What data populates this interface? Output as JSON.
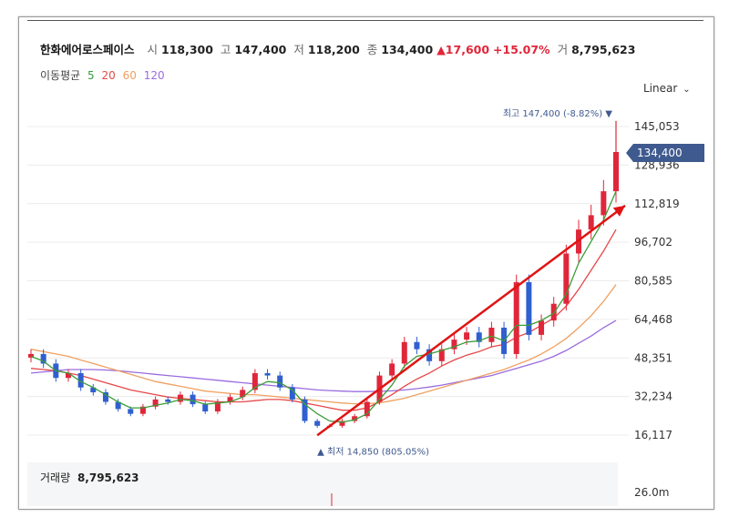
{
  "header": {
    "name": "한화에어로스페이스",
    "open_label": "시",
    "open": "118,300",
    "high_label": "고",
    "high": "147,400",
    "low_label": "저",
    "low": "118,200",
    "close_label": "종",
    "close": "134,400",
    "change": "▲17,600",
    "change_pct": "+15.07%",
    "volume_label": "거",
    "volume": "8,795,623"
  },
  "ma_legend": {
    "label": "이동평균",
    "p5": "5",
    "p20": "20",
    "p60": "60",
    "p120": "120"
  },
  "scale": "Linear",
  "colors": {
    "up": "#e0263a",
    "down": "#2f5fd0",
    "ma5": "#3a9d3a",
    "ma20": "#e64848",
    "ma60": "#f0a060",
    "ma120": "#9a6ce0",
    "trend": "#e01414",
    "badge": "#3f5a8e"
  },
  "chart_data": {
    "type": "line",
    "y_ticks": [
      "145,053",
      "128,936",
      "112,819",
      "96,702",
      "80,585",
      "64,468",
      "48,351",
      "32,234",
      "16,117"
    ],
    "y_tick_values": [
      145053,
      128936,
      112819,
      96702,
      80585,
      64468,
      48351,
      32234,
      16117
    ],
    "ylim": [
      12000,
      158000
    ],
    "current_price": "134,400",
    "current_price_value": 134400,
    "high_annotation": "최고 147,400 (-8.82%)",
    "high_value": 147400,
    "low_annotation": "최저 14,850 (805.05%)",
    "low_value": 14850,
    "n": 48,
    "close": [
      50000,
      46000,
      40000,
      42000,
      36000,
      34000,
      30000,
      27000,
      25000,
      28000,
      31000,
      30000,
      33000,
      29000,
      26000,
      30000,
      32000,
      35000,
      42000,
      41000,
      36000,
      31000,
      22000,
      20000,
      20000,
      22000,
      24000,
      30000,
      41000,
      46000,
      55000,
      52000,
      47000,
      52000,
      56000,
      59000,
      55000,
      61000,
      50000,
      80000,
      58000,
      64000,
      71000,
      92000,
      102000,
      108000,
      118000,
      134400
    ],
    "ma5": [
      49000,
      47000,
      43000,
      42000,
      38500,
      36000,
      33000,
      30000,
      27500,
      27500,
      28500,
      29500,
      31000,
      30500,
      29000,
      29500,
      30000,
      32000,
      36000,
      38500,
      38000,
      35000,
      29000,
      25000,
      22000,
      21500,
      22500,
      25000,
      31000,
      37000,
      45000,
      49000,
      50000,
      51500,
      53000,
      55000,
      55500,
      57500,
      55500,
      62000,
      62000,
      64000,
      67000,
      75000,
      88000,
      97000,
      106000,
      118000
    ],
    "ma20": [
      44000,
      43500,
      43000,
      42000,
      41000,
      39500,
      38000,
      36500,
      35000,
      34000,
      33000,
      32000,
      31500,
      31000,
      30500,
      30000,
      30000,
      30000,
      30500,
      31000,
      31000,
      30500,
      29500,
      28500,
      27500,
      26500,
      26500,
      27500,
      30000,
      33000,
      36500,
      39500,
      42000,
      45000,
      47500,
      49500,
      51000,
      53000,
      54000,
      57000,
      59000,
      62000,
      65000,
      70000,
      77000,
      85000,
      93000,
      102000
    ],
    "ma60": [
      52000,
      51000,
      50000,
      49000,
      47500,
      46000,
      44500,
      43000,
      41500,
      40000,
      38500,
      37500,
      36500,
      35500,
      34500,
      34000,
      33500,
      33000,
      33000,
      32500,
      32000,
      31500,
      31000,
      30500,
      30000,
      29500,
      29200,
      29200,
      29600,
      30500,
      31500,
      33000,
      34500,
      36000,
      37500,
      39000,
      40500,
      42000,
      43500,
      45500,
      47500,
      50000,
      53000,
      56500,
      61000,
      66000,
      72000,
      79000
    ],
    "ma120": [
      42000,
      42500,
      43000,
      43500,
      43500,
      43500,
      43300,
      43000,
      42500,
      42000,
      41500,
      41000,
      40500,
      40000,
      39500,
      39000,
      38500,
      38000,
      37500,
      37000,
      36500,
      36000,
      35500,
      35000,
      34700,
      34500,
      34300,
      34300,
      34400,
      34600,
      35000,
      35500,
      36200,
      37000,
      38000,
      39000,
      40000,
      41000,
      42500,
      44000,
      45500,
      47000,
      49000,
      51500,
      54500,
      57500,
      61000,
      64000
    ],
    "trend_start": 16000,
    "trend_end": 112000
  },
  "volume_panel": {
    "label": "거래량",
    "value": "8,795,623",
    "max_tick": "26.0m"
  }
}
